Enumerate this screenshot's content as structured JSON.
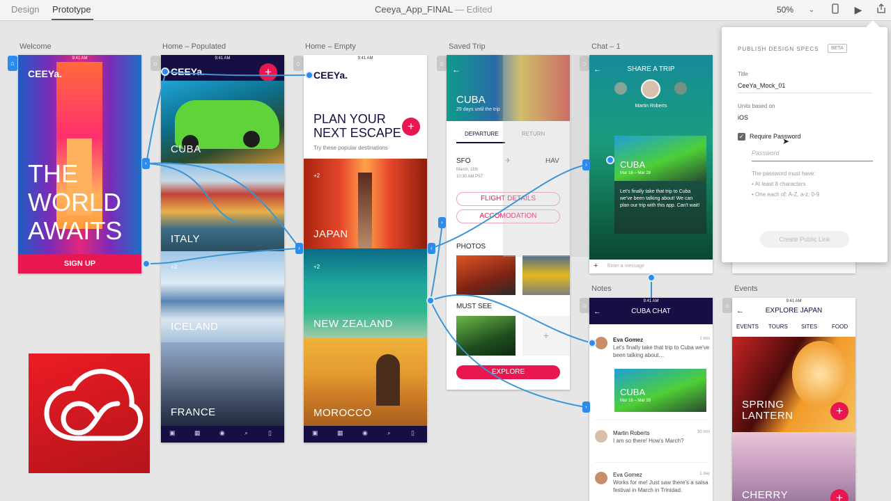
{
  "toolbar": {
    "tabs": [
      "Design",
      "Prototype"
    ],
    "doc_name": "Ceeya_App_FINAL",
    "doc_status": "—  Edited",
    "zoom": "50%",
    "icons": [
      "device-preview-icon",
      "play-icon",
      "share-icon"
    ]
  },
  "artboards": {
    "welcome": {
      "label": "Welcome",
      "logo": "CEEYa.",
      "headline": [
        "THE",
        "WORLD",
        "AWAITS"
      ],
      "cta": "SIGN UP"
    },
    "home_populated": {
      "label": "Home – Populated",
      "logo": "CEEYa.",
      "destinations": [
        "CUBA",
        "ITALY",
        "ICELAND",
        "FRANCE"
      ],
      "badge": "+2"
    },
    "home_empty": {
      "label": "Home – Empty",
      "logo": "CEEYa.",
      "headline_1": "PLAN YOUR",
      "headline_2": "NEXT ESCAPE",
      "subtitle": "Try these popular destinations",
      "destinations": [
        "JAPAN",
        "NEW ZEALAND",
        "MOROCCO"
      ],
      "badge": "+2"
    },
    "saved_trip": {
      "label": "Saved Trip",
      "title": "CUBA",
      "subtitle": "29 days until the trip",
      "tabs": [
        "DEPARTURE",
        "RETURN"
      ],
      "from_code": "SFO",
      "to_code": "HAV",
      "date": "March, 11th",
      "time": "10:30 AM PST",
      "buttons": [
        "FLIGHT DETAILS",
        "ACCOMODATION"
      ],
      "section_photos": "PHOTOS",
      "section_must_see": "MUST SEE",
      "cta": "EXPLORE"
    },
    "chat_1": {
      "label": "Chat – 1",
      "title": "SHARE A TRIP",
      "person": "Martin Roberts",
      "card_title": "CUBA",
      "card_dates": "Mar 16 – Mar 28",
      "card_text": "Let's finally take that trip to Cuba we've been talking about! We can plan our trip with this app. Can't wait!",
      "input_placeholder": "Enter a message"
    },
    "notes": {
      "label": "Notes",
      "time": "9:41 AM",
      "title": "CUBA CHAT",
      "messages": [
        {
          "name": "Eva Gomez",
          "time": "1 min",
          "text": "Let's finally take that trip to Cuba we've been talking about…"
        },
        {
          "name": "Martin Roberts",
          "time": "30 min",
          "text": "I am so there! How's March?"
        },
        {
          "name": "Eva Gomez",
          "time": "1 day",
          "text": "Works for me! Just saw there's a salsa festival in March in Trinidad."
        }
      ],
      "card_title": "CUBA",
      "card_dates": "Mar 16 – Mar 28"
    },
    "events": {
      "label": "Events",
      "time": "9:41 AM",
      "title": "EXPLORE JAPAN",
      "tabs": [
        "EVENTS",
        "TOURS",
        "SITES",
        "FOOD"
      ],
      "items": [
        "SPRING\nLANTERN",
        "CHERRY"
      ]
    }
  },
  "publish_panel": {
    "heading": "PUBLISH DESIGN SPECS",
    "badge": "BETA",
    "title_label": "Title",
    "title_value": "CeeYa_Mock_01",
    "units_label": "Units based on",
    "units_value": "iOS",
    "checkbox_label": "Require Password",
    "checkbox_checked": true,
    "password_placeholder": "Password",
    "rules_heading": "The password must have:",
    "rules": [
      "• At least 8 characters",
      "• One each of: A-Z, a-z, 0-9"
    ],
    "button": "Create Public Link"
  },
  "colors": {
    "accent": "#e8174f",
    "wire": "#3a95d6",
    "navy": "#160f43",
    "cc_red": "#da1f26"
  }
}
